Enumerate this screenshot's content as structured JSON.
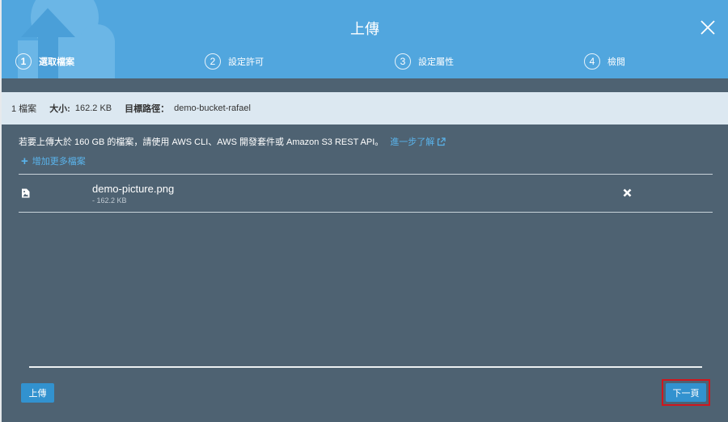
{
  "dialog": {
    "title": "上傳",
    "steps": [
      {
        "num": "1",
        "label": "選取檔案"
      },
      {
        "num": "2",
        "label": "設定許可"
      },
      {
        "num": "3",
        "label": "設定屬性"
      },
      {
        "num": "4",
        "label": "檢閱"
      }
    ],
    "active_step": 1
  },
  "summary": {
    "count": "1 檔案",
    "size_label": "大小:",
    "size_value": "162.2 KB",
    "dest_label": "目標路徑：",
    "dest_value": "demo-bucket-rafael"
  },
  "notice": {
    "text": "若要上傳大於 160 GB 的檔案，請使用 AWS CLI、AWS 開發套件或 Amazon S3 REST API。",
    "link_text": "進一步了解"
  },
  "add_more_label": "增加更多檔案",
  "files": [
    {
      "name": "demo-picture.png",
      "size": "- 162.2 KB"
    }
  ],
  "footer": {
    "upload_label": "上傳",
    "next_label": "下一頁"
  },
  "colors": {
    "header": "#51a6de",
    "body": "#4e6272",
    "infobar": "#dce8f1",
    "primary_button": "#3292cf",
    "link": "#5ab4ec",
    "highlight": "#d0161d"
  },
  "icons": {
    "close": "close-icon",
    "file": "image-file-icon",
    "remove": "remove-x-icon",
    "external": "external-link-icon",
    "deco": "cloud-upload-icon"
  }
}
